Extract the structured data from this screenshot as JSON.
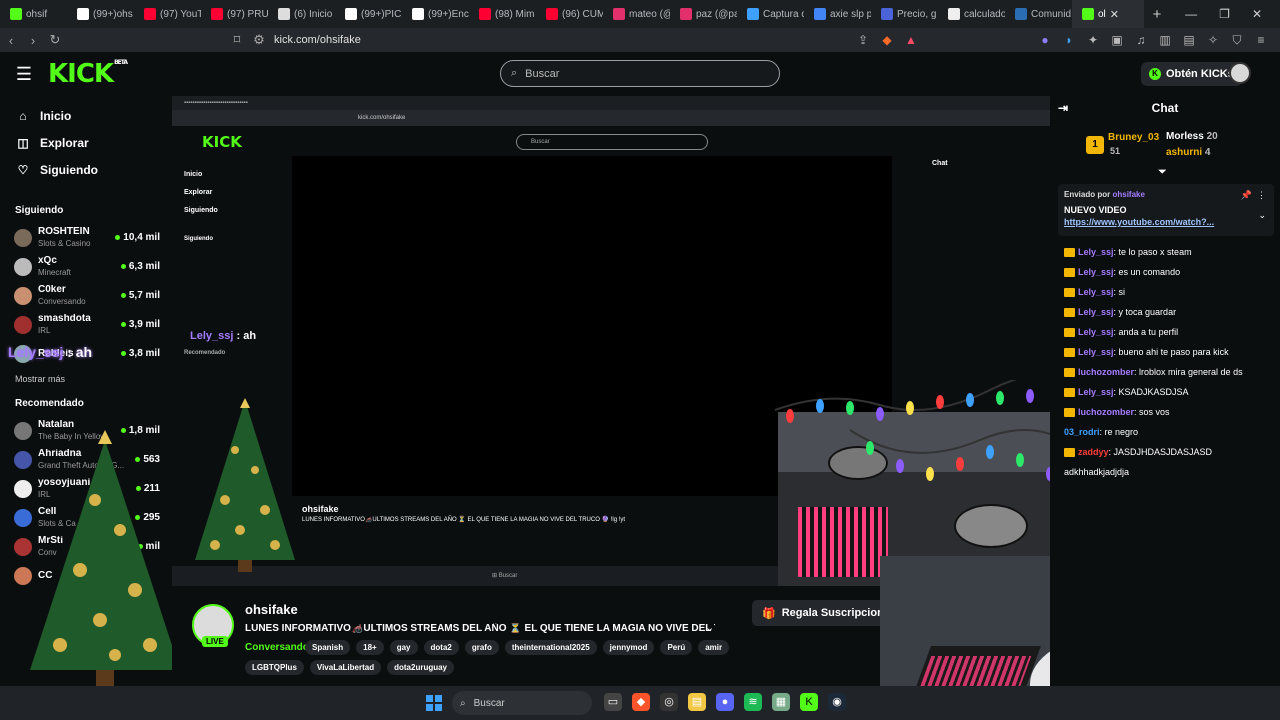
{
  "tabs": [
    {
      "label": "ohsif",
      "color": "#53fc18"
    },
    {
      "label": "(99+)ohs",
      "color": "#ffffff"
    },
    {
      "label": "(97) YouT",
      "color": "#ff0033"
    },
    {
      "label": "(97) PRUE",
      "color": "#ff0033"
    },
    {
      "label": "(6) Inicio",
      "color": "#dddddd"
    },
    {
      "label": "(99+)PIC",
      "color": "#ffffff"
    },
    {
      "label": "(99+)Enc",
      "color": "#ffffff"
    },
    {
      "label": "(98) Mim",
      "color": "#ff0033"
    },
    {
      "label": "(96) CUM",
      "color": "#ff0033"
    },
    {
      "label": "mateo (@",
      "color": "#e1306c"
    },
    {
      "label": "paz (@pa",
      "color": "#e1306c"
    },
    {
      "label": "Captura d",
      "color": "#3ea0ff"
    },
    {
      "label": "axie slp p",
      "color": "#4285f4"
    },
    {
      "label": "Precio, g",
      "color": "#4a63d8"
    },
    {
      "label": "calculado",
      "color": "#eeeeee"
    },
    {
      "label": "Comunid",
      "color": "#2a6db3"
    }
  ],
  "active_tab": {
    "label": "ol",
    "color": "#53fc18"
  },
  "address": {
    "url": "kick.com/ohsifake"
  },
  "header": {
    "search_placeholder": "Buscar",
    "get_kicks": "Obtén KICKs",
    "logo": "KICK",
    "logo_badge": "BETA"
  },
  "nav": [
    {
      "label": "Inicio",
      "icon": "home-icon"
    },
    {
      "label": "Explorar",
      "icon": "compass-icon"
    },
    {
      "label": "Siguiendo",
      "icon": "heart-icon"
    }
  ],
  "following_title": "Siguiendo",
  "following": [
    {
      "name": "ROSHTEIN",
      "sub": "Slots & Casino",
      "viewers": "10,4 mil",
      "color": "#7a6a5a"
    },
    {
      "name": "xQc",
      "sub": "Minecraft",
      "viewers": "6,3 mil",
      "color": "#bbbbbb"
    },
    {
      "name": "C0ker",
      "sub": "Conversando",
      "viewers": "5,7 mil",
      "color": "#c89070"
    },
    {
      "name": "smashdota",
      "sub": "IRL",
      "viewers": "3,9 mil",
      "color": "#a03030"
    },
    {
      "name": "Rebleis",
      "sub": "",
      "viewers": "3,8 mil",
      "color": "#8aa"
    }
  ],
  "show_more": "Mostrar más",
  "recommended_title": "Recomendado",
  "recommended": [
    {
      "name": "Natalan",
      "sub": "The Baby In Yellow",
      "viewers": "1,8 mil",
      "color": "#777"
    },
    {
      "name": "Ahriadna",
      "sub": "Grand Theft Auto V (G...",
      "viewers": "563",
      "color": "#4455aa"
    },
    {
      "name": "yosoyjuani",
      "sub": "IRL",
      "viewers": "211",
      "color": "#eee"
    },
    {
      "name": "Cell",
      "sub": "Slots & Ca",
      "viewers": "295",
      "color": "#3a6cd8"
    },
    {
      "name": "MrSti",
      "sub": "Conv",
      "viewers": "mil",
      "color": "#aa3333"
    },
    {
      "name": "CC",
      "sub": "",
      "viewers": "",
      "color": "#cc7755"
    }
  ],
  "overlay_chat": {
    "user": "Lely_ssj",
    "text": " : ah"
  },
  "inner": {
    "url": "kick.com/ohsifake",
    "search": "Buscar",
    "nav": [
      "Inicio",
      "Explorar",
      "Siguiendo"
    ],
    "following": "Siguiendo",
    "recommended": "Recomendado",
    "chat": "Chat",
    "streamer": "ohsifake",
    "title": "LUNES INFORMATIVO🦽ULTIMOS STREAMS DEL AÑO ⏳ EL QUE TIENE LA MAGIA NO VIVE DEL TRUCO 🔮 !lg !yt",
    "taskbar_search": "Buscar"
  },
  "stream": {
    "name": "ohsifake",
    "live": "LIVE",
    "title": "LUNES INFORMATIVO🦽ULTIMOS STREAMS DEL AÑO ⏳ EL QUE TIENE LA MAGIA NO VIVE DEL TR...",
    "category": "Conversando",
    "tags": [
      "Spanish",
      "18+",
      "gay",
      "dota2",
      "grafo",
      "theinternational2025",
      "jennymod",
      "Perú",
      "amir"
    ],
    "tags2": [
      "LGBTQPlus",
      "VivaLaLibertad",
      "dota2uruguay"
    ],
    "sub_button": "Regala Suscripciones"
  },
  "chat": {
    "title": "Chat",
    "leaders": {
      "first": "Bruney_03",
      "first_score": "51",
      "second": "Morless",
      "second_score": "20",
      "third": "ashurni",
      "third_score": "4"
    },
    "pinned": {
      "by_label": "Enviado por",
      "by_user": "ohsifake",
      "title": "NUEVO VIDEO",
      "link": "https://www.youtube.com/watch?..."
    },
    "messages": [
      {
        "user": "Lely_ssj",
        "text": ": te lo paso x steam",
        "color": "#a57cff",
        "badge": true
      },
      {
        "user": "Lely_ssj",
        "text": ": es un comando",
        "color": "#a57cff",
        "badge": true
      },
      {
        "user": "Lely_ssj",
        "text": ": si",
        "color": "#a57cff",
        "badge": true
      },
      {
        "user": "Lely_ssj",
        "text": ": y toca guardar",
        "color": "#a57cff",
        "badge": true
      },
      {
        "user": "Lely_ssj",
        "text": ": anda a tu perfil",
        "color": "#a57cff",
        "badge": true
      },
      {
        "user": "Lely_ssj",
        "text": ": bueno ahi te paso para kick",
        "color": "#a57cff",
        "badge": true
      },
      {
        "user": "luchozomber",
        "text": ": lroblox mira general de ds",
        "color": "#a57cff",
        "badge": true
      },
      {
        "user": "Lely_ssj",
        "text": ": KSADJKASDJSA",
        "color": "#a57cff",
        "badge": true
      },
      {
        "user": "luchozomber",
        "text": ": sos vos",
        "color": "#a57cff",
        "badge": true
      },
      {
        "user": "03_rodri",
        "text": ": re negro",
        "color": "#3ea0ff",
        "badge": false
      },
      {
        "user": "zaddyy",
        "text": ": JASDJHDASJDASJASD",
        "color": "#ff3d3d",
        "badge": true
      },
      {
        "user": "",
        "text": "adkhhadkjadjdja",
        "color": "#ffffff",
        "badge": false
      }
    ]
  },
  "taskbar": {
    "search": "Buscar"
  },
  "colors": {
    "accent": "#53fc18",
    "bg": "#0b0e0f"
  }
}
